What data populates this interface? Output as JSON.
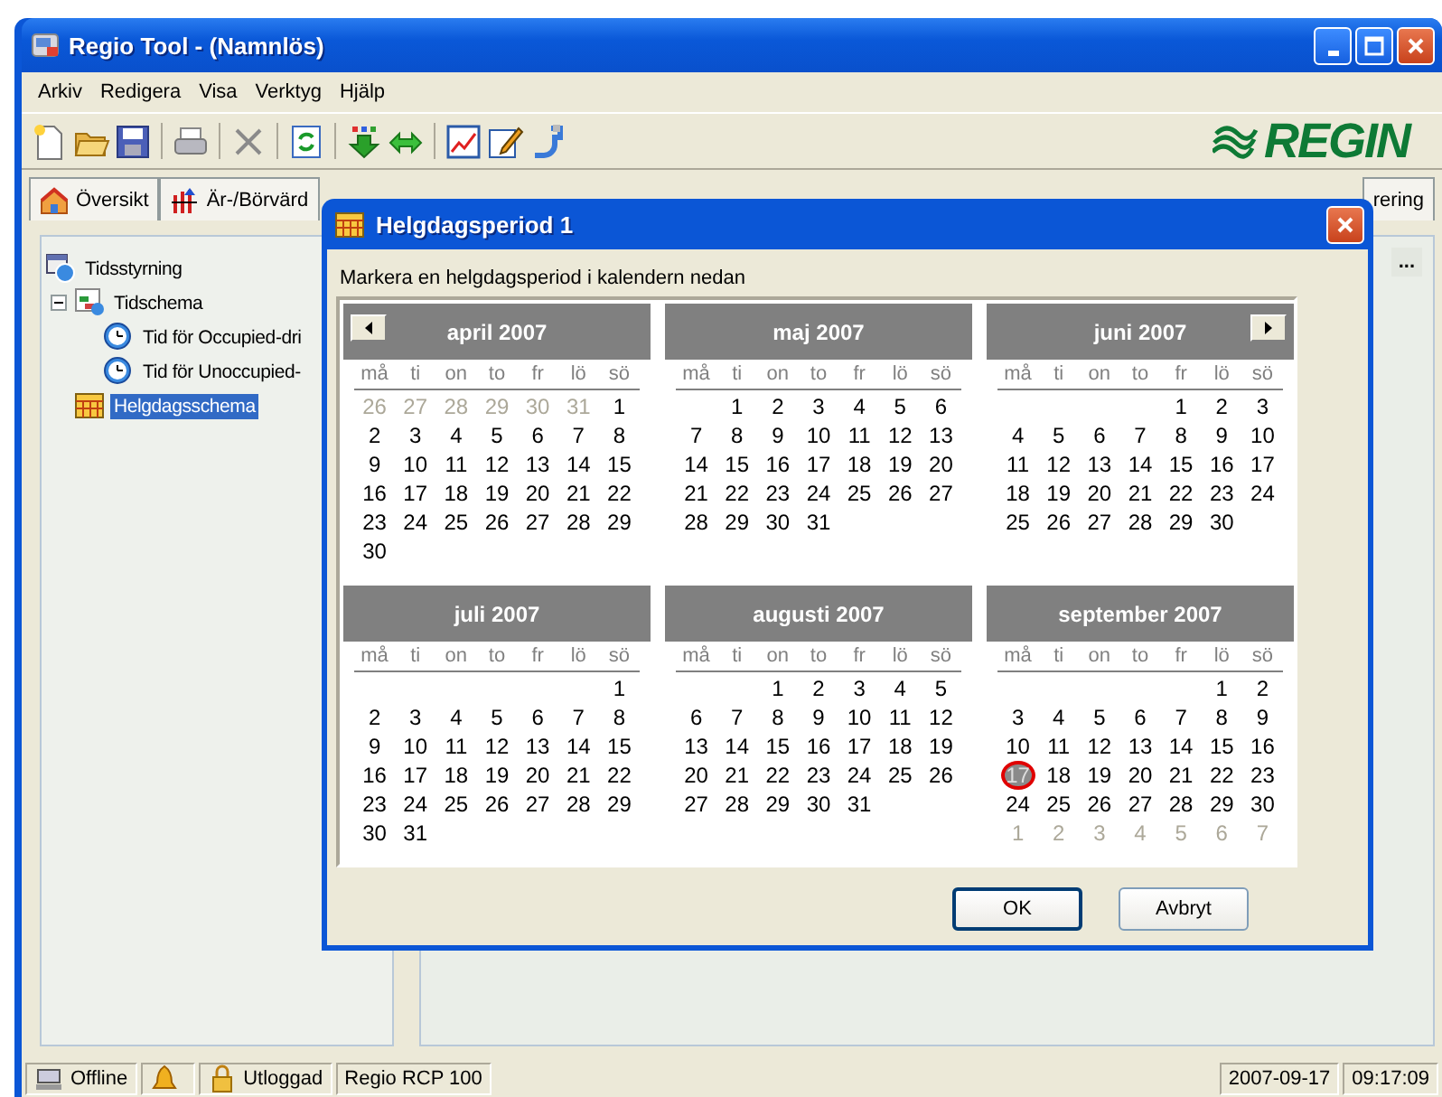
{
  "window": {
    "title": "Regio Tool - (Namnlös)"
  },
  "menu": [
    "Arkiv",
    "Redigera",
    "Visa",
    "Verktyg",
    "Hjälp"
  ],
  "toolbar": [
    {
      "kind": "new"
    },
    {
      "kind": "open"
    },
    {
      "kind": "save"
    },
    {
      "kind": "sep"
    },
    {
      "kind": "print"
    },
    {
      "kind": "sep"
    },
    {
      "kind": "delete"
    },
    {
      "kind": "sep"
    },
    {
      "kind": "refresh"
    },
    {
      "kind": "sep"
    },
    {
      "kind": "download"
    },
    {
      "kind": "swap"
    },
    {
      "kind": "sep"
    },
    {
      "kind": "chart"
    },
    {
      "kind": "edit"
    },
    {
      "kind": "plug"
    }
  ],
  "logo": {
    "text": "REGIN"
  },
  "tabs": [
    {
      "label": "Översikt",
      "kind": "home",
      "selected": false
    },
    {
      "label": "Är-/Börvärd",
      "kind": "values",
      "selected": false
    },
    {
      "label": "rering",
      "kind": "plain",
      "selected": false
    }
  ],
  "tree": [
    {
      "label": "Tidsstyrning",
      "kind": "root",
      "selected": false,
      "children": [
        {
          "label": "Tidschema",
          "kind": "schedule",
          "selected": false,
          "expanded": true,
          "children": [
            {
              "label": "Tid för Occupied-dri",
              "kind": "clock",
              "selected": false
            },
            {
              "label": "Tid för Unoccupied-",
              "kind": "clock",
              "selected": false
            }
          ]
        },
        {
          "label": "Helgdagsschema",
          "kind": "calendar",
          "selected": true
        }
      ]
    }
  ],
  "more_button": "...",
  "dialog": {
    "title": "Helgdagsperiod 1",
    "instruction": "Markera en helgdagsperiod i kalendern nedan",
    "months": [
      {
        "title": "april 2007",
        "nav_button": {
          "kind": "prev"
        },
        "weekdays": [
          "må",
          "ti",
          "on",
          "to",
          "fr",
          "lö",
          "sö"
        ],
        "days": [
          {
            "text": "26",
            "kind": "other"
          },
          {
            "text": "27",
            "kind": "other"
          },
          {
            "text": "28",
            "kind": "other"
          },
          {
            "text": "29",
            "kind": "other"
          },
          {
            "text": "30",
            "kind": "other"
          },
          {
            "text": "31",
            "kind": "other"
          },
          {
            "text": "1",
            "kind": "day"
          },
          {
            "text": "2",
            "kind": "day"
          },
          {
            "text": "3",
            "kind": "day"
          },
          {
            "text": "4",
            "kind": "day"
          },
          {
            "text": "5",
            "kind": "day"
          },
          {
            "text": "6",
            "kind": "day"
          },
          {
            "text": "7",
            "kind": "day"
          },
          {
            "text": "8",
            "kind": "day"
          },
          {
            "text": "9",
            "kind": "day"
          },
          {
            "text": "10",
            "kind": "day"
          },
          {
            "text": "11",
            "kind": "day"
          },
          {
            "text": "12",
            "kind": "day"
          },
          {
            "text": "13",
            "kind": "day"
          },
          {
            "text": "14",
            "kind": "day"
          },
          {
            "text": "15",
            "kind": "day"
          },
          {
            "text": "16",
            "kind": "day"
          },
          {
            "text": "17",
            "kind": "day"
          },
          {
            "text": "18",
            "kind": "day"
          },
          {
            "text": "19",
            "kind": "day"
          },
          {
            "text": "20",
            "kind": "day"
          },
          {
            "text": "21",
            "kind": "day"
          },
          {
            "text": "22",
            "kind": "day"
          },
          {
            "text": "23",
            "kind": "day"
          },
          {
            "text": "24",
            "kind": "day"
          },
          {
            "text": "25",
            "kind": "day"
          },
          {
            "text": "26",
            "kind": "day"
          },
          {
            "text": "27",
            "kind": "day"
          },
          {
            "text": "28",
            "kind": "day"
          },
          {
            "text": "29",
            "kind": "day"
          },
          {
            "text": "30",
            "kind": "day"
          }
        ]
      },
      {
        "title": "maj 2007",
        "weekdays": [
          "må",
          "ti",
          "on",
          "to",
          "fr",
          "lö",
          "sö"
        ],
        "days": [
          {
            "kind": "blank"
          },
          {
            "text": "1",
            "kind": "day"
          },
          {
            "text": "2",
            "kind": "day"
          },
          {
            "text": "3",
            "kind": "day"
          },
          {
            "text": "4",
            "kind": "day"
          },
          {
            "text": "5",
            "kind": "day"
          },
          {
            "text": "6",
            "kind": "day"
          },
          {
            "text": "7",
            "kind": "day"
          },
          {
            "text": "8",
            "kind": "day"
          },
          {
            "text": "9",
            "kind": "day"
          },
          {
            "text": "10",
            "kind": "day"
          },
          {
            "text": "11",
            "kind": "day"
          },
          {
            "text": "12",
            "kind": "day"
          },
          {
            "text": "13",
            "kind": "day"
          },
          {
            "text": "14",
            "kind": "day"
          },
          {
            "text": "15",
            "kind": "day"
          },
          {
            "text": "16",
            "kind": "day"
          },
          {
            "text": "17",
            "kind": "day"
          },
          {
            "text": "18",
            "kind": "day"
          },
          {
            "text": "19",
            "kind": "day"
          },
          {
            "text": "20",
            "kind": "day"
          },
          {
            "text": "21",
            "kind": "day"
          },
          {
            "text": "22",
            "kind": "day"
          },
          {
            "text": "23",
            "kind": "day"
          },
          {
            "text": "24",
            "kind": "day"
          },
          {
            "text": "25",
            "kind": "day"
          },
          {
            "text": "26",
            "kind": "day"
          },
          {
            "text": "27",
            "kind": "day"
          },
          {
            "text": "28",
            "kind": "day"
          },
          {
            "text": "29",
            "kind": "day"
          },
          {
            "text": "30",
            "kind": "day"
          },
          {
            "text": "31",
            "kind": "day"
          }
        ]
      },
      {
        "title": "juni 2007",
        "nav_button": {
          "kind": "next"
        },
        "weekdays": [
          "må",
          "ti",
          "on",
          "to",
          "fr",
          "lö",
          "sö"
        ],
        "days": [
          {
            "kind": "blank"
          },
          {
            "kind": "blank"
          },
          {
            "kind": "blank"
          },
          {
            "kind": "blank"
          },
          {
            "text": "1",
            "kind": "day"
          },
          {
            "text": "2",
            "kind": "day"
          },
          {
            "text": "3",
            "kind": "day"
          },
          {
            "text": "4",
            "kind": "day"
          },
          {
            "text": "5",
            "kind": "day"
          },
          {
            "text": "6",
            "kind": "day"
          },
          {
            "text": "7",
            "kind": "day"
          },
          {
            "text": "8",
            "kind": "day"
          },
          {
            "text": "9",
            "kind": "day"
          },
          {
            "text": "10",
            "kind": "day"
          },
          {
            "text": "11",
            "kind": "day"
          },
          {
            "text": "12",
            "kind": "day"
          },
          {
            "text": "13",
            "kind": "day"
          },
          {
            "text": "14",
            "kind": "day"
          },
          {
            "text": "15",
            "kind": "day"
          },
          {
            "text": "16",
            "kind": "day"
          },
          {
            "text": "17",
            "kind": "day"
          },
          {
            "text": "18",
            "kind": "day"
          },
          {
            "text": "19",
            "kind": "day"
          },
          {
            "text": "20",
            "kind": "day"
          },
          {
            "text": "21",
            "kind": "day"
          },
          {
            "text": "22",
            "kind": "day"
          },
          {
            "text": "23",
            "kind": "day"
          },
          {
            "text": "24",
            "kind": "day"
          },
          {
            "text": "25",
            "kind": "day"
          },
          {
            "text": "26",
            "kind": "day"
          },
          {
            "text": "27",
            "kind": "day"
          },
          {
            "text": "28",
            "kind": "day"
          },
          {
            "text": "29",
            "kind": "day"
          },
          {
            "text": "30",
            "kind": "day"
          }
        ]
      },
      {
        "title": "juli 2007",
        "weekdays": [
          "må",
          "ti",
          "on",
          "to",
          "fr",
          "lö",
          "sö"
        ],
        "days": [
          {
            "kind": "blank"
          },
          {
            "kind": "blank"
          },
          {
            "kind": "blank"
          },
          {
            "kind": "blank"
          },
          {
            "kind": "blank"
          },
          {
            "kind": "blank"
          },
          {
            "text": "1",
            "kind": "day"
          },
          {
            "text": "2",
            "kind": "day"
          },
          {
            "text": "3",
            "kind": "day"
          },
          {
            "text": "4",
            "kind": "day"
          },
          {
            "text": "5",
            "kind": "day"
          },
          {
            "text": "6",
            "kind": "day"
          },
          {
            "text": "7",
            "kind": "day"
          },
          {
            "text": "8",
            "kind": "day"
          },
          {
            "text": "9",
            "kind": "day"
          },
          {
            "text": "10",
            "kind": "day"
          },
          {
            "text": "11",
            "kind": "day"
          },
          {
            "text": "12",
            "kind": "day"
          },
          {
            "text": "13",
            "kind": "day"
          },
          {
            "text": "14",
            "kind": "day"
          },
          {
            "text": "15",
            "kind": "day"
          },
          {
            "text": "16",
            "kind": "day"
          },
          {
            "text": "17",
            "kind": "day"
          },
          {
            "text": "18",
            "kind": "day"
          },
          {
            "text": "19",
            "kind": "day"
          },
          {
            "text": "20",
            "kind": "day"
          },
          {
            "text": "21",
            "kind": "day"
          },
          {
            "text": "22",
            "kind": "day"
          },
          {
            "text": "23",
            "kind": "day"
          },
          {
            "text": "24",
            "kind": "day"
          },
          {
            "text": "25",
            "kind": "day"
          },
          {
            "text": "26",
            "kind": "day"
          },
          {
            "text": "27",
            "kind": "day"
          },
          {
            "text": "28",
            "kind": "day"
          },
          {
            "text": "29",
            "kind": "day"
          },
          {
            "text": "30",
            "kind": "day"
          },
          {
            "text": "31",
            "kind": "day"
          }
        ]
      },
      {
        "title": "augusti 2007",
        "weekdays": [
          "må",
          "ti",
          "on",
          "to",
          "fr",
          "lö",
          "sö"
        ],
        "days": [
          {
            "kind": "blank"
          },
          {
            "kind": "blank"
          },
          {
            "text": "1",
            "kind": "day"
          },
          {
            "text": "2",
            "kind": "day"
          },
          {
            "text": "3",
            "kind": "day"
          },
          {
            "text": "4",
            "kind": "day"
          },
          {
            "text": "5",
            "kind": "day"
          },
          {
            "text": "6",
            "kind": "day"
          },
          {
            "text": "7",
            "kind": "day"
          },
          {
            "text": "8",
            "kind": "day"
          },
          {
            "text": "9",
            "kind": "day"
          },
          {
            "text": "10",
            "kind": "day"
          },
          {
            "text": "11",
            "kind": "day"
          },
          {
            "text": "12",
            "kind": "day"
          },
          {
            "text": "13",
            "kind": "day"
          },
          {
            "text": "14",
            "kind": "day"
          },
          {
            "text": "15",
            "kind": "day"
          },
          {
            "text": "16",
            "kind": "day"
          },
          {
            "text": "17",
            "kind": "day"
          },
          {
            "text": "18",
            "kind": "day"
          },
          {
            "text": "19",
            "kind": "day"
          },
          {
            "text": "20",
            "kind": "day"
          },
          {
            "text": "21",
            "kind": "day"
          },
          {
            "text": "22",
            "kind": "day"
          },
          {
            "text": "23",
            "kind": "day"
          },
          {
            "text": "24",
            "kind": "day"
          },
          {
            "text": "25",
            "kind": "day"
          },
          {
            "text": "26",
            "kind": "day"
          },
          {
            "text": "27",
            "kind": "day"
          },
          {
            "text": "28",
            "kind": "day"
          },
          {
            "text": "29",
            "kind": "day"
          },
          {
            "text": "30",
            "kind": "day"
          },
          {
            "text": "31",
            "kind": "day"
          }
        ]
      },
      {
        "title": "september 2007",
        "weekdays": [
          "må",
          "ti",
          "on",
          "to",
          "fr",
          "lö",
          "sö"
        ],
        "days": [
          {
            "kind": "blank"
          },
          {
            "kind": "blank"
          },
          {
            "kind": "blank"
          },
          {
            "kind": "blank"
          },
          {
            "kind": "blank"
          },
          {
            "text": "1",
            "kind": "day"
          },
          {
            "text": "2",
            "kind": "day"
          },
          {
            "text": "3",
            "kind": "day"
          },
          {
            "text": "4",
            "kind": "day"
          },
          {
            "text": "5",
            "kind": "day"
          },
          {
            "text": "6",
            "kind": "day"
          },
          {
            "text": "7",
            "kind": "day"
          },
          {
            "text": "8",
            "kind": "day"
          },
          {
            "text": "9",
            "kind": "day"
          },
          {
            "text": "10",
            "kind": "day"
          },
          {
            "text": "11",
            "kind": "day"
          },
          {
            "text": "12",
            "kind": "day"
          },
          {
            "text": "13",
            "kind": "day"
          },
          {
            "text": "14",
            "kind": "day"
          },
          {
            "text": "15",
            "kind": "day"
          },
          {
            "text": "16",
            "kind": "day"
          },
          {
            "text": "17",
            "kind": "today"
          },
          {
            "text": "18",
            "kind": "day"
          },
          {
            "text": "19",
            "kind": "day"
          },
          {
            "text": "20",
            "kind": "day"
          },
          {
            "text": "21",
            "kind": "day"
          },
          {
            "text": "22",
            "kind": "day"
          },
          {
            "text": "23",
            "kind": "day"
          },
          {
            "text": "24",
            "kind": "day"
          },
          {
            "text": "25",
            "kind": "day"
          },
          {
            "text": "26",
            "kind": "day"
          },
          {
            "text": "27",
            "kind": "day"
          },
          {
            "text": "28",
            "kind": "day"
          },
          {
            "text": "29",
            "kind": "day"
          },
          {
            "text": "30",
            "kind": "day"
          },
          {
            "text": "1",
            "kind": "other"
          },
          {
            "text": "2",
            "kind": "other"
          },
          {
            "text": "3",
            "kind": "other"
          },
          {
            "text": "4",
            "kind": "other"
          },
          {
            "text": "5",
            "kind": "other"
          },
          {
            "text": "6",
            "kind": "other"
          },
          {
            "text": "7",
            "kind": "other"
          }
        ]
      }
    ],
    "buttons": [
      {
        "label": "OK",
        "default": true
      },
      {
        "label": "Avbryt",
        "default": false
      }
    ]
  },
  "status_bar": {
    "left": [
      {
        "kind": "connection",
        "text": "Offline"
      },
      {
        "kind": "alarm"
      },
      {
        "kind": "lock",
        "text": "Utloggad"
      },
      {
        "kind": "plain",
        "text": "Regio RCP 100"
      }
    ],
    "right": [
      "2007-09-17",
      "09:17:09"
    ]
  }
}
